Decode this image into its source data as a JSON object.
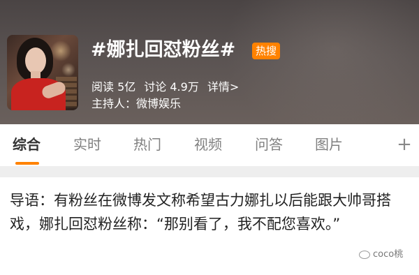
{
  "topic": {
    "title": "#娜扎回怼粉丝#",
    "badge": "热搜",
    "reads": "阅读 5亿",
    "discussions": "讨论 4.9万",
    "details": "详情>",
    "host": "主持人：微博娱乐"
  },
  "tabs": [
    {
      "label": "综合",
      "active": true
    },
    {
      "label": "实时",
      "active": false
    },
    {
      "label": "热门",
      "active": false
    },
    {
      "label": "视频",
      "active": false
    },
    {
      "label": "问答",
      "active": false
    },
    {
      "label": "图片",
      "active": false
    }
  ],
  "add_tab_icon": "plus-icon",
  "intro": {
    "text": "导语：有粉丝在微博发文称希望古力娜扎以后能跟大帅哥搭戏，娜扎回怼粉丝称：“那别看了，我不配您喜欢。”"
  },
  "watermark": "coco桃",
  "colors": {
    "accent": "#ff8200",
    "header_bg": "#5a5352",
    "tab_active": "#333333",
    "tab_inactive": "#808080"
  }
}
